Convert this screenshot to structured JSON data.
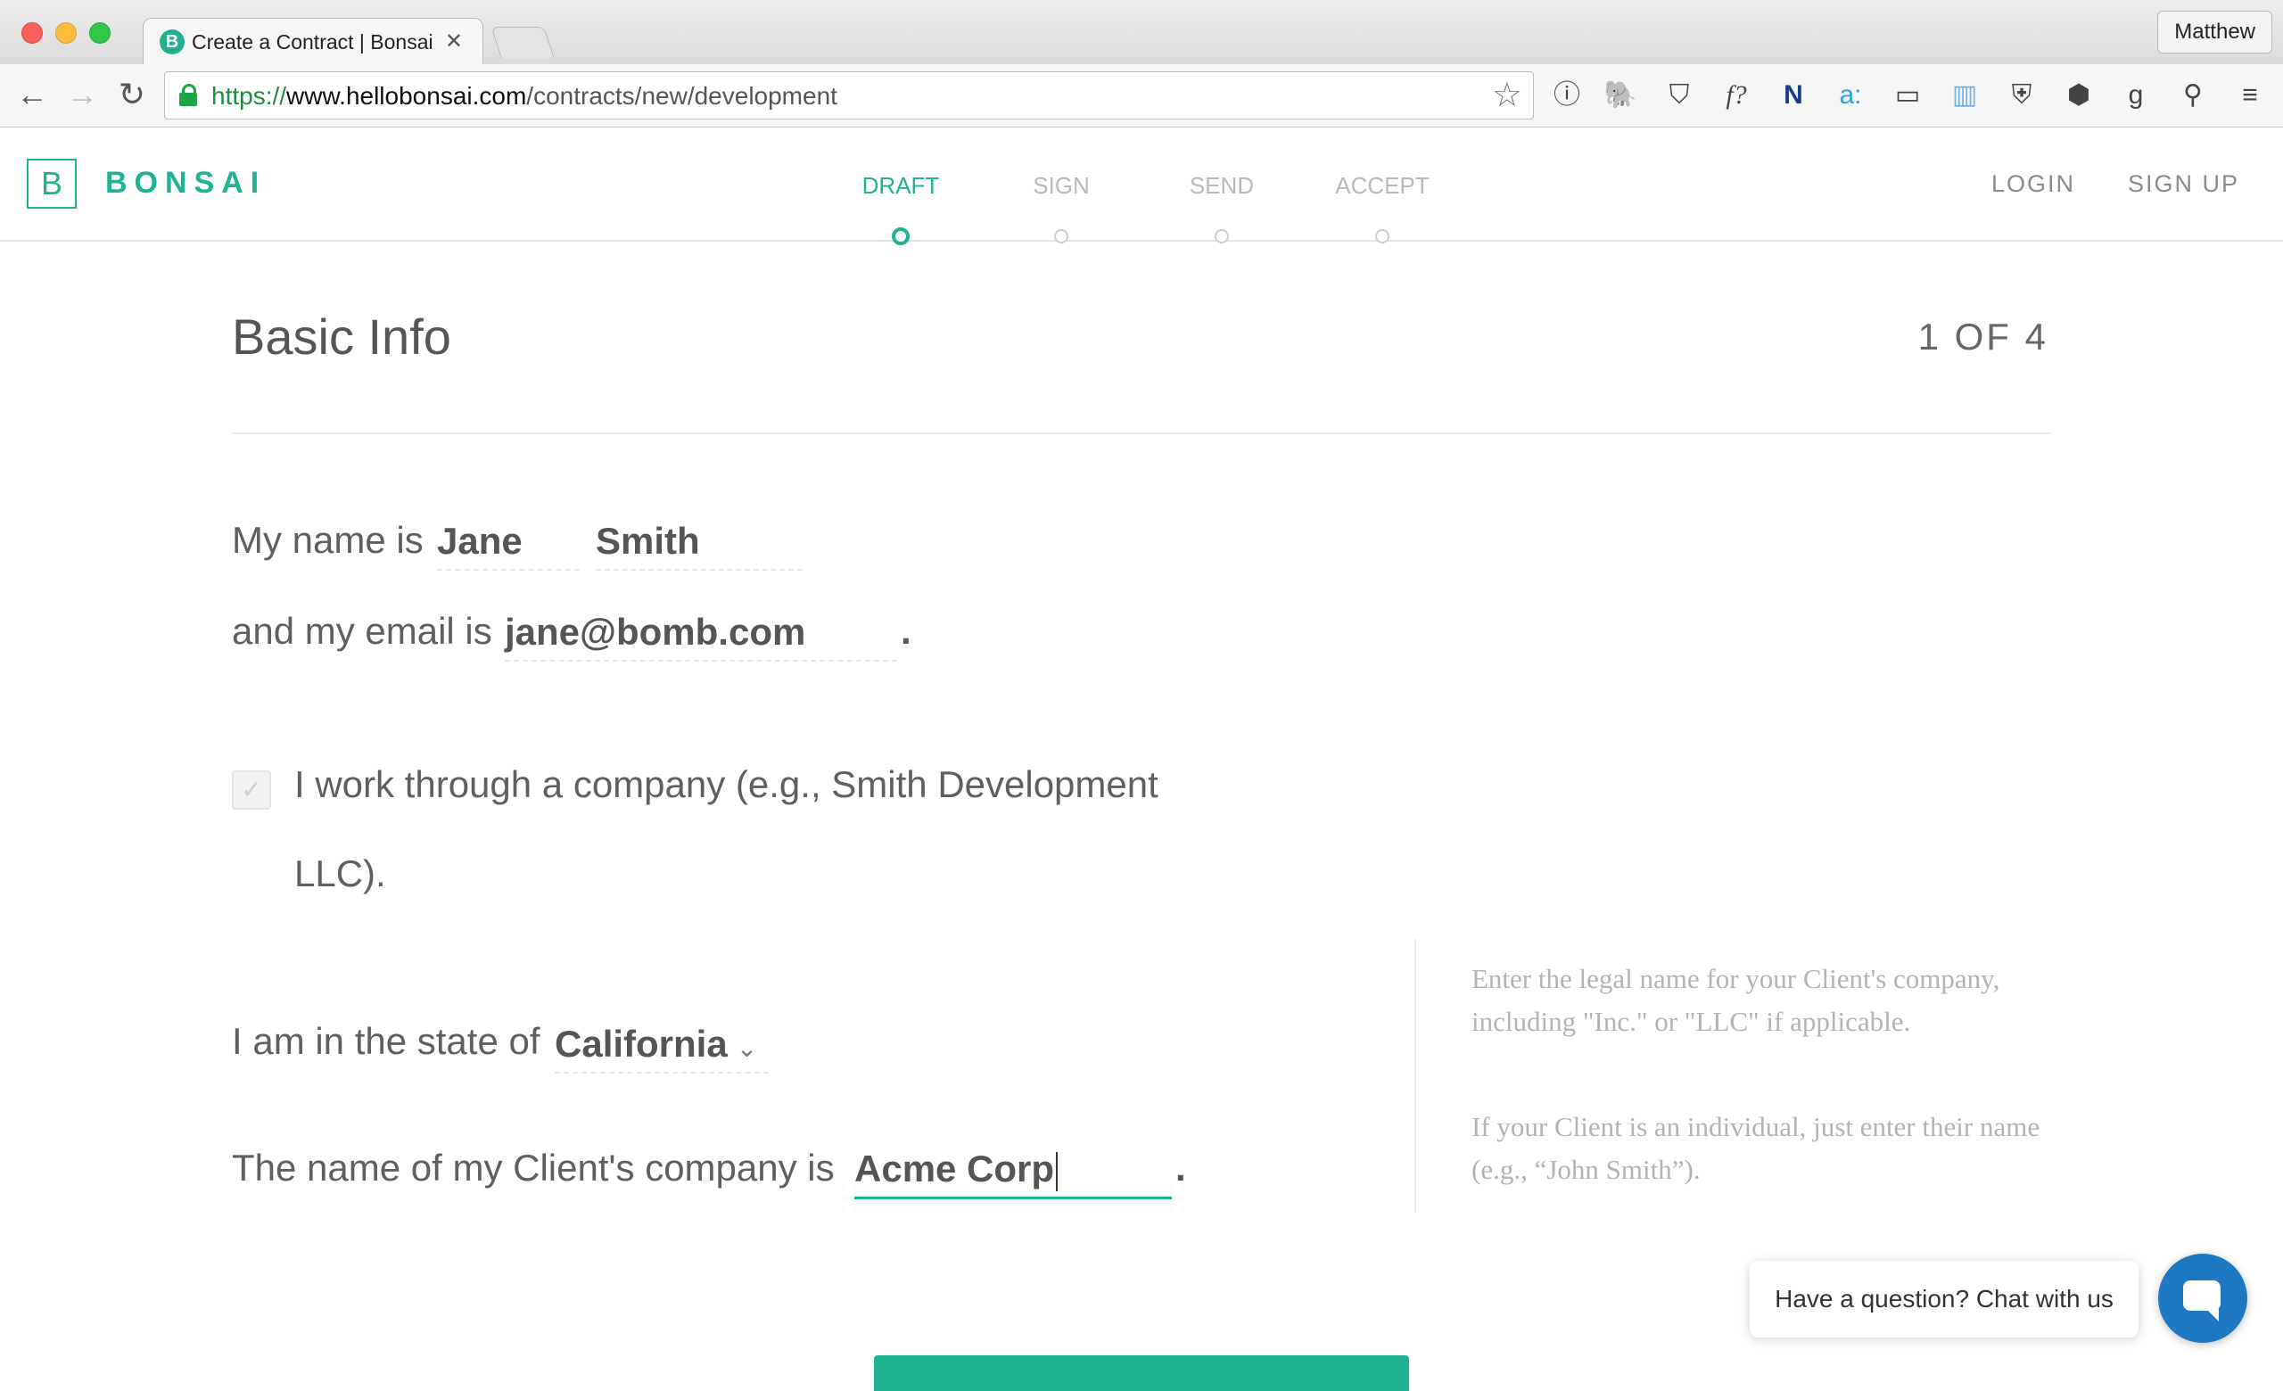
{
  "browser": {
    "tab_title": "Create a Contract | Bonsai",
    "tab_favicon": "B",
    "profile_name": "Matthew",
    "url_scheme": "https://",
    "url_host": "www.hellobonsai.com",
    "url_path": "/contracts/new/development"
  },
  "site": {
    "logo_letter": "B",
    "logo_text": "BONSAI",
    "steps": [
      {
        "label": "DRAFT",
        "active": true
      },
      {
        "label": "SIGN",
        "active": false
      },
      {
        "label": "SEND",
        "active": false
      },
      {
        "label": "ACCEPT",
        "active": false
      }
    ],
    "login_label": "LOGIN",
    "signup_label": "SIGN UP"
  },
  "form": {
    "title": "Basic Info",
    "step_counter": "1 OF 4",
    "name_prefix": "My name is",
    "first_name": "Jane",
    "last_name": "Smith",
    "email_prefix": "and my email is",
    "email": "jane@bomb.com",
    "period": ".",
    "company_checkbox_label": "I work through a company (e.g., Smith Development LLC).",
    "company_checkbox_checked": false,
    "state_prefix": "I am in the state of",
    "state": "California",
    "client_prefix": "The name of my Client's company is",
    "client_company": "Acme Corp",
    "hint_1": "Enter the legal name for your Client's company, including \"Inc.\" or \"LLC\" if applicable.",
    "hint_2": "If your Client is an individual, just enter their name (e.g., “John Smith”)."
  },
  "chat": {
    "prompt": "Have a question? Chat with us"
  },
  "colors": {
    "brand": "#1fb392",
    "chat": "#1e78c2"
  }
}
